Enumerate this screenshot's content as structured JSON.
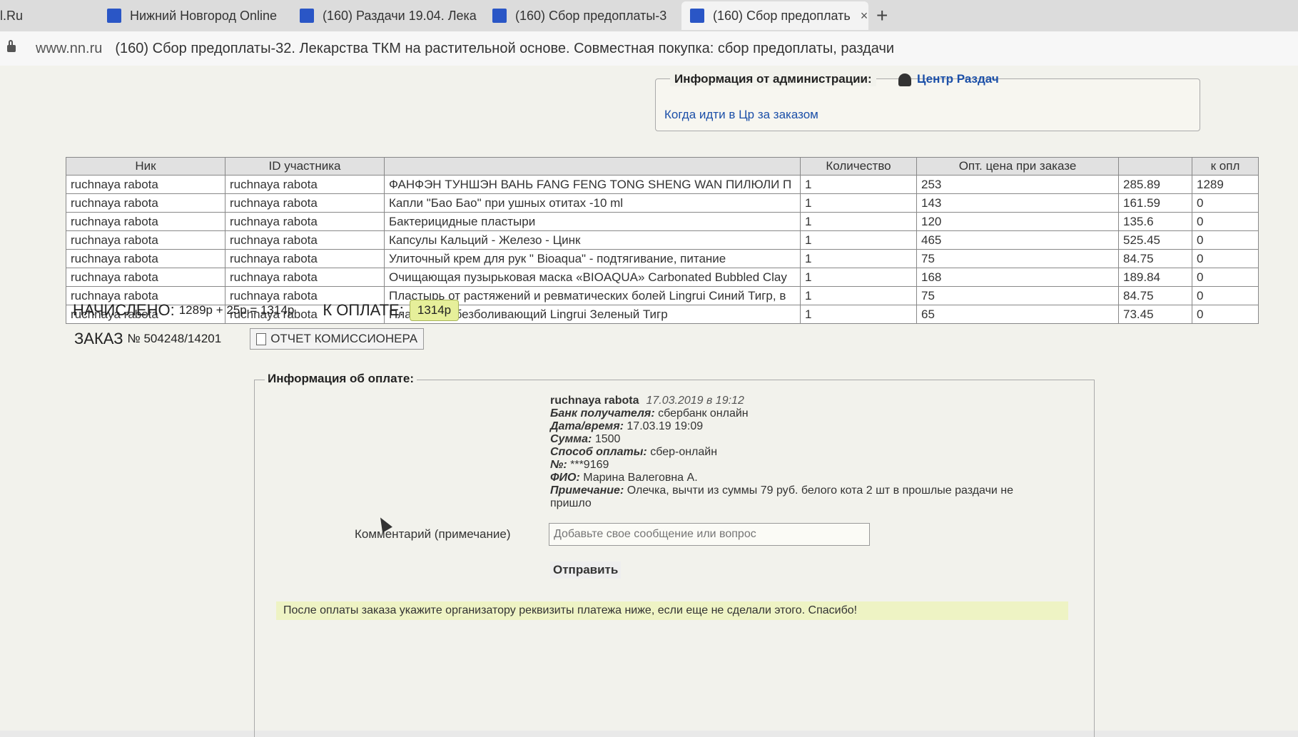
{
  "tabs": [
    {
      "label": "l.Ru"
    },
    {
      "label": "Нижний Новгород Online"
    },
    {
      "label": "(160) Раздачи 19.04. Лека"
    },
    {
      "label": "(160) Сбор предоплаты-3"
    },
    {
      "label": "(160) Сбор предоплать"
    }
  ],
  "tab_close": "×",
  "new_tab": "+",
  "address": {
    "host": "www.nn.ru",
    "title": "(160) Сбор предоплаты-32. Лекарства ТКМ на растительной основе. Совместная покупка: сбор предоплаты, раздачи"
  },
  "admin": {
    "title": "Информация от администрации:",
    "center_link": "Центр Раздач",
    "link": "Когда идти в Цр за заказом"
  },
  "table": {
    "headers": [
      "Ник",
      "ID участника",
      "",
      "Количество",
      "Опт. цена при заказе",
      "",
      "к опл"
    ],
    "rows": [
      [
        "ruchnaya rabota",
        "ruchnaya rabota",
        "ФАНФЭН ТУНШЭН ВАНЬ FANG FENG TONG SHENG WAN ПИЛЮЛИ П",
        "1",
        "253",
        "285.89",
        "1289"
      ],
      [
        "ruchnaya rabota",
        "ruchnaya rabota",
        "Капли \"Бао Бао\" при ушных отитах -10 ml",
        "1",
        "143",
        "161.59",
        "0"
      ],
      [
        "ruchnaya rabota",
        "ruchnaya rabota",
        "Бактерицидные пластыри",
        "1",
        "120",
        "135.6",
        "0"
      ],
      [
        "ruchnaya rabota",
        "ruchnaya rabota",
        "Капсулы Кальций - Железо - Цинк",
        "1",
        "465",
        "525.45",
        "0"
      ],
      [
        "ruchnaya rabota",
        "ruchnaya rabota",
        "Улиточный крем для рук \" Bioaqua\" - подтягивание, питание",
        "1",
        "75",
        "84.75",
        "0"
      ],
      [
        "ruchnaya rabota",
        "ruchnaya rabota",
        "Очищающая пузырьковая маска «BIOAQUA» Carbonated Bubbled Clay",
        "1",
        "168",
        "189.84",
        "0"
      ],
      [
        "ruchnaya rabota",
        "ruchnaya rabota",
        "Пластырь от растяжений и ревматических болей Lingrui Синий Тигр, в",
        "1",
        "75",
        "84.75",
        "0"
      ],
      [
        "ruchnaya rabota",
        "ruchnaya rabota",
        "Пластырь обезболивающий Lingrui Зеленый Тигр",
        "1",
        "65",
        "73.45",
        "0"
      ]
    ]
  },
  "totals": {
    "accrued_label": "НАЧИСЛЕНО:",
    "accrued_value": "1289р + 25р = 1314р",
    "due_label": "К ОПЛАТЕ:",
    "due_value": "1314р"
  },
  "order": {
    "label": "ЗАКАЗ",
    "number": "№ 504248/14201",
    "report_button": "ОТЧЕТ КОМИССИОНЕРА"
  },
  "payment": {
    "title": "Информация об оплате:",
    "user": "ruchnaya rabota",
    "posted": "17.03.2019 в 19:12",
    "fields": [
      {
        "label": "Банк получателя:",
        "value": "сбербанк онлайн"
      },
      {
        "label": "Дата/время:",
        "value": "17.03.19 19:09"
      },
      {
        "label": "Сумма:",
        "value": "1500"
      },
      {
        "label": "Способ оплаты:",
        "value": "сбер-онлайн"
      },
      {
        "label": "№:",
        "value": "***9169"
      },
      {
        "label": "ФИО:",
        "value": "Марина Валеговна А."
      },
      {
        "label": "Примечание:",
        "value": "Олечка, вычти из суммы 79 руб. белого кота 2 шт в прошлые раздачи не пришло"
      }
    ],
    "comment_label": "Комментарий (примечание)",
    "comment_placeholder": "Добавьте свое сообщение или вопрос",
    "send_button": "Отправить",
    "notice": "После оплаты заказа укажите организатору реквизиты платежа ниже, если еще не сделали этого. Спасибо!"
  }
}
